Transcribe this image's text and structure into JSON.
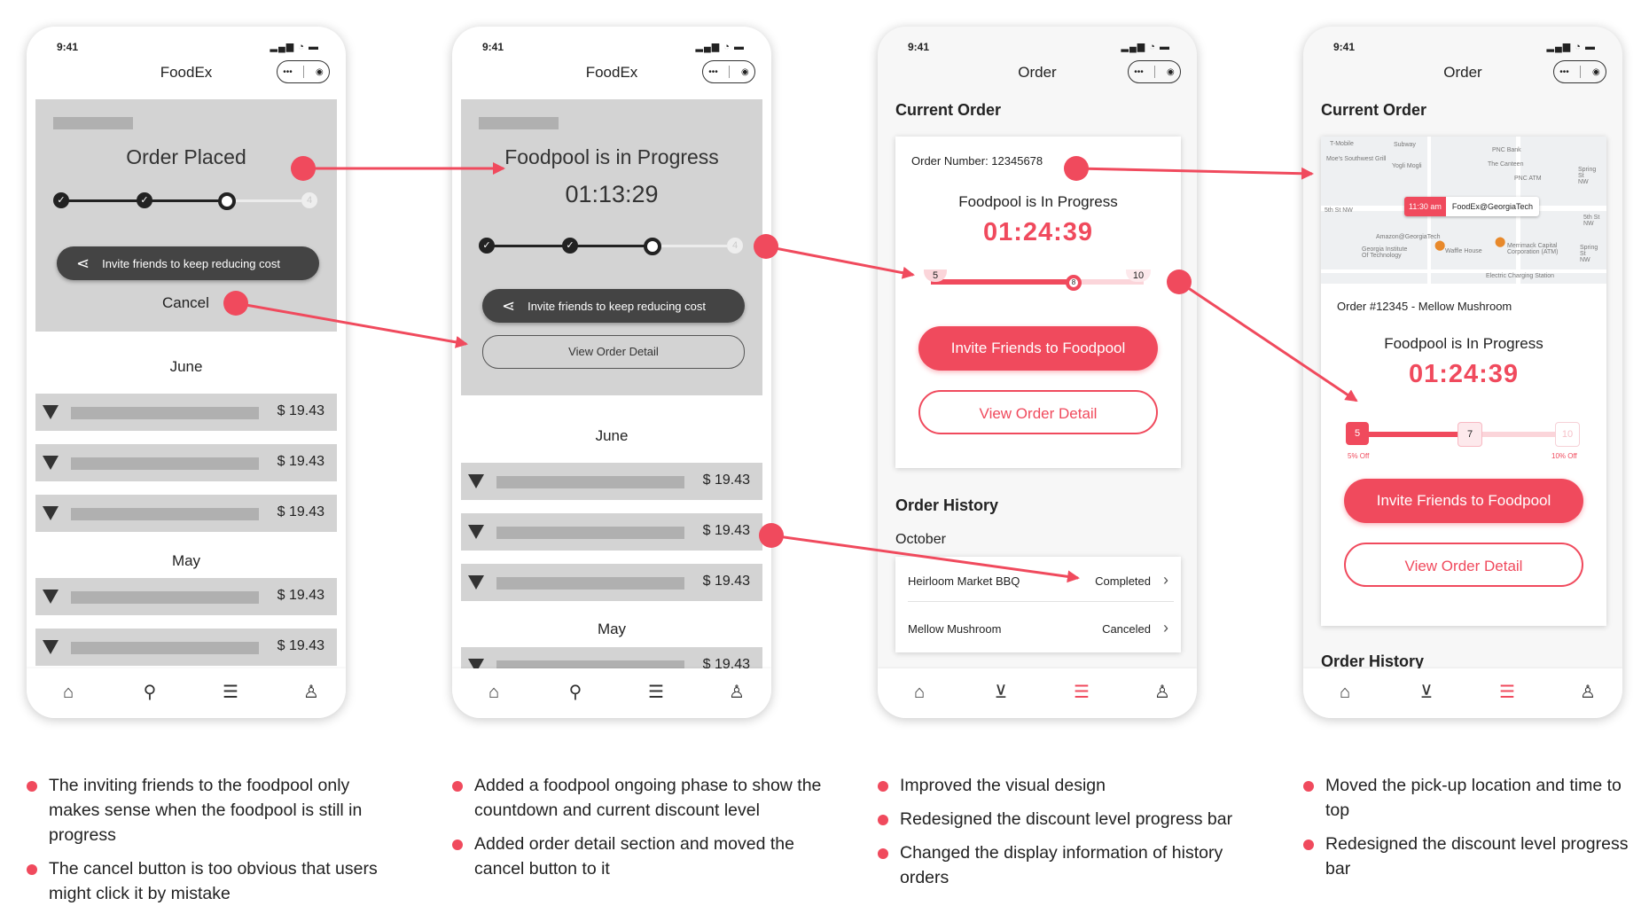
{
  "status_time": "9:41",
  "status_icons": "signal-wifi-battery",
  "accent": "#f04a5d",
  "screen1": {
    "title": "FoodEx",
    "stage": "Order Placed",
    "invite": "Invite friends to keep reducing cost",
    "cancel": "Cancel",
    "progress_steps": [
      {
        "label": ""
      },
      {
        "label": ""
      },
      {
        "label": ""
      },
      {
        "label": "4"
      }
    ],
    "months": [
      {
        "name": "June",
        "rows": [
          "$ 19.43",
          "$ 19.43",
          "$ 19.43"
        ]
      },
      {
        "name": "May",
        "rows": [
          "$ 19.43",
          "$ 19.43"
        ]
      }
    ]
  },
  "screen2": {
    "title": "FoodEx",
    "stage": "Foodpool is in Progress",
    "timer": "01:13:29",
    "invite": "Invite friends to keep reducing cost",
    "view_detail": "View Order Detail",
    "progress_steps": [
      {
        "label": ""
      },
      {
        "label": ""
      },
      {
        "label": ""
      },
      {
        "label": "4"
      }
    ],
    "months": [
      {
        "name": "June",
        "rows": [
          "$ 19.43",
          "$ 19.43",
          "$ 19.43"
        ]
      },
      {
        "name": "May",
        "rows": [
          "$ 19.43"
        ]
      }
    ]
  },
  "screen3": {
    "title": "Order",
    "current_order": "Current Order",
    "order_number": "Order Number: 12345678",
    "stage": "Foodpool is In Progress",
    "timer": "01:24:39",
    "levels": {
      "start": "5",
      "current": "8",
      "end": "10"
    },
    "invite_btn": "Invite Friends to Foodpool",
    "detail_btn": "View Order Detail",
    "history_title": "Order History",
    "history_month": "October",
    "history": [
      {
        "name": "Heirloom Market BBQ",
        "status": "Completed"
      },
      {
        "name": "Mellow Mushroom",
        "status": "Canceled"
      }
    ]
  },
  "screen4": {
    "title": "Order",
    "current_order": "Current Order",
    "map": {
      "pickup_time": "11:30 am",
      "pickup_place": "FoodEx@GeorgiaTech",
      "labels": [
        "T-Mobile",
        "Subway",
        "PNC Bank",
        "Moe's Southwest Grill",
        "Yogli Mogli",
        "The Canteen",
        "PNC ATM",
        "5th St NW",
        "5th St NW",
        "Amazon@GeorgiaTech",
        "Georgia Institute Of Technology",
        "Waffle House",
        "Merrimack Capital Corporation (ATM)",
        "Electric Charging Station",
        "Spring St NW",
        "Spring St NW"
      ]
    },
    "order_line": "Order #12345 - Mellow Mushroom",
    "stage": "Foodpool is In Progress",
    "timer": "01:24:39",
    "levels": {
      "start": "5",
      "current": "7",
      "end": "10",
      "start_off": "5% Off",
      "end_off": "10% Off"
    },
    "invite_btn": "Invite Friends to Foodpool",
    "detail_btn": "View Order Detail",
    "history_title": "Order History"
  },
  "notes": [
    [
      "The inviting friends to the foodpool only makes sense when the foodpool is still in progress",
      "The cancel button is too obvious that users might click it by mistake"
    ],
    [
      "Added a foodpool ongoing phase to show the countdown and current discount level",
      "Added order detail section and moved the cancel button to it"
    ],
    [
      "Improved the visual design",
      "Redesigned the discount level progress bar",
      "Changed the display information of history orders"
    ],
    [
      "Moved the pick-up location and time to top",
      "Redesigned the discount level progress bar"
    ]
  ],
  "tab_icons": [
    "home-icon",
    "search-icon",
    "list-icon",
    "profile-icon"
  ],
  "tab_icons_v2": [
    "home-icon",
    "cart-icon",
    "list-icon",
    "profile-icon"
  ]
}
